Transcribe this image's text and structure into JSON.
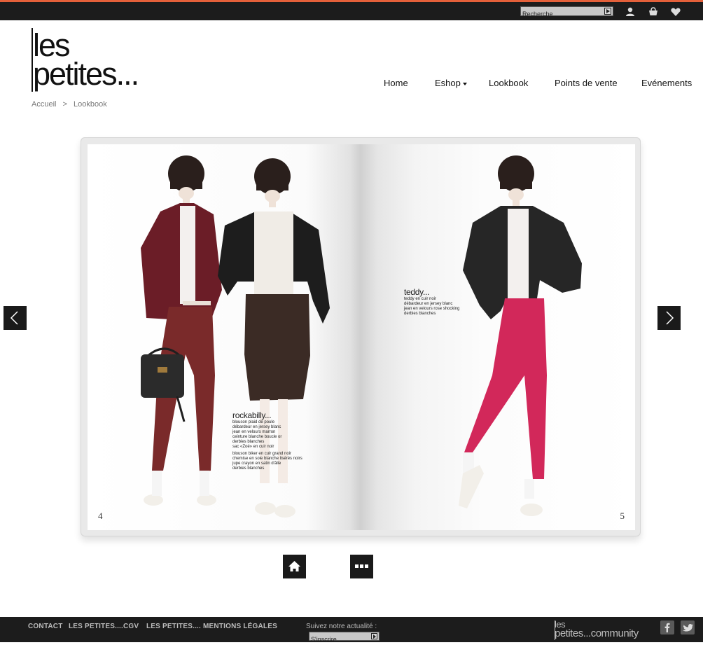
{
  "colors": {
    "accent": "#e4603a",
    "topbar": "#1c1c1c",
    "button": "#1a1a1a",
    "text_muted": "#777777"
  },
  "topbar": {
    "search_placeholder": "Recherche",
    "icons": [
      "user-icon",
      "cart-icon",
      "heart-icon"
    ]
  },
  "logo": {
    "line1": "les",
    "line2": "petites..."
  },
  "nav": {
    "home": "Home",
    "eshop": "Eshop",
    "lookbook": "Lookbook",
    "points_de_vente": "Points de vente",
    "evenements": "Evénements"
  },
  "breadcrumb": {
    "home": "Accueil",
    "separator": ">",
    "current": "Lookbook"
  },
  "lookbook": {
    "left_page": {
      "number": "4",
      "caption_title": "rockabilly...",
      "caption_lines": [
        "blouson plaid de poule",
        "débardeur en jersey blanc",
        "jean en velours marron",
        "ceinture blanche boucle or",
        "derbies blanches",
        "sac «Zoé» en cuir noir",
        "",
        "blouson biker en cuir grand noir",
        "chemise en soie blanche lisérés noirs",
        "jupe crayon en satin d'âlle",
        "derbies blanches"
      ]
    },
    "right_page": {
      "number": "5",
      "caption_title": "teddy...",
      "caption_lines": [
        "teddy en cuir noir",
        "débardeur en jersey blanc",
        "jean en velours rose shocking",
        "derbies blanches"
      ]
    },
    "controls": [
      "home-icon",
      "grid-icon"
    ]
  },
  "footer": {
    "links": {
      "contact": "CONTACT",
      "cgv": "LES PETITES....CGV",
      "mentions": "LES PETITES.... MENTIONS LÉGALES"
    },
    "follow_label": "Suivez notre actualité :",
    "subscribe_placeholder": "S'inscrire",
    "community": {
      "line1": "les",
      "line2": "petites...community"
    },
    "social": [
      "facebook-icon",
      "twitter-icon"
    ]
  }
}
